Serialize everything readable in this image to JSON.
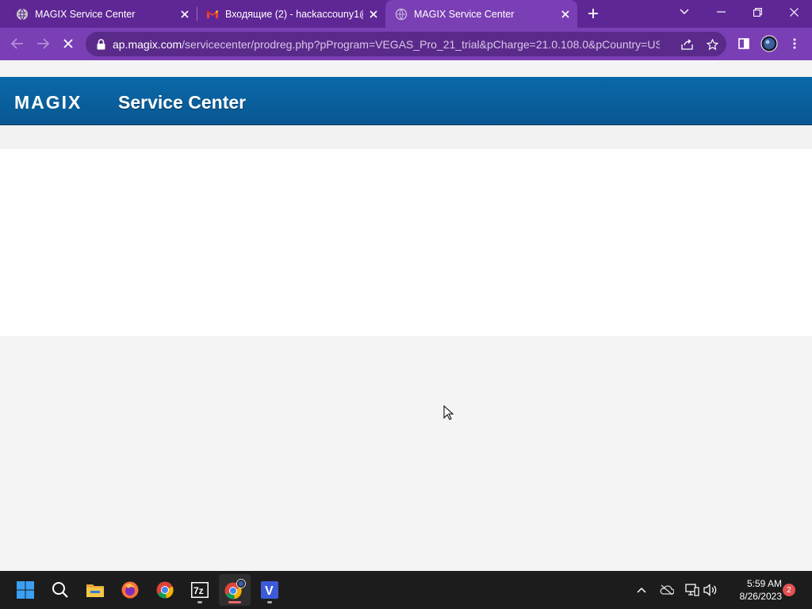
{
  "browser": {
    "tabs": [
      {
        "title": "MAGIX Service Center",
        "favicon": "globe-icon"
      },
      {
        "title": "Входящие (2) - hackaccouny1@g",
        "favicon": "gmail-icon"
      },
      {
        "title": "MAGIX Service Center",
        "favicon": "loading-globe-icon",
        "active": true
      }
    ],
    "url": {
      "host": "ap.magix.com",
      "path": "/servicecenter/prodreg.php?pProgram=VEGAS_Pro_21_trial&pCharge=21.0.108.0&pCountry=US&..."
    },
    "colors": {
      "frame": "#5f2795",
      "active": "#7a3fb4",
      "omnibox": "#5a2a8a"
    }
  },
  "page": {
    "logo": "MAGIX",
    "title": "Service Center",
    "colors": {
      "brandbar": "#0a62a0",
      "background": "#f4f4f4"
    }
  },
  "taskbar": {
    "apps": [
      "windows-start",
      "search",
      "file-explorer",
      "firefox",
      "chrome",
      "7zip",
      "chrome-profile",
      "vegas"
    ],
    "time": "5:59 AM",
    "date": "8/26/2023",
    "notifications": "2"
  }
}
